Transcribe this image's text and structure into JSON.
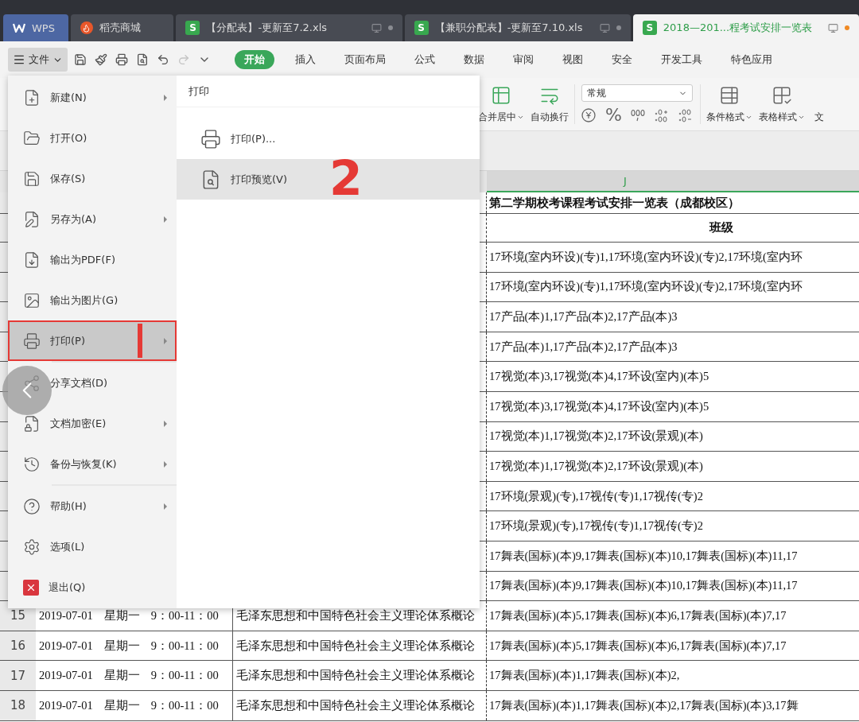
{
  "tabs": [
    {
      "kind": "home",
      "label": "WPS",
      "selected": false
    },
    {
      "kind": "store",
      "label": "稻壳商城",
      "selected": false
    },
    {
      "kind": "sheet",
      "badge": "S",
      "label": "【分配表】-更新至7.2.xls",
      "selected": false
    },
    {
      "kind": "sheet",
      "badge": "S",
      "label": "【兼职分配表】-更新至7.10.xls",
      "selected": false
    },
    {
      "kind": "sheet",
      "badge": "S",
      "label": "2018—201...程考试安排一览表",
      "selected": true
    }
  ],
  "menu_bar": {
    "file_button": {
      "label": "文件",
      "pressed": true
    },
    "quick_access": [
      {
        "kind": "save",
        "disabled": false
      },
      {
        "kind": "format",
        "disabled": false
      },
      {
        "kind": "print",
        "disabled": false
      },
      {
        "kind": "preview",
        "disabled": false
      },
      {
        "kind": "undo",
        "disabled": false
      },
      {
        "kind": "redo",
        "disabled": true
      },
      {
        "kind": "more",
        "disabled": false
      }
    ],
    "ribbon_tabs": [
      {
        "label": "开始",
        "selected": true
      },
      {
        "label": "插入",
        "selected": false
      },
      {
        "label": "页面布局",
        "selected": false
      },
      {
        "label": "公式",
        "selected": false
      },
      {
        "label": "数据",
        "selected": false
      },
      {
        "label": "审阅",
        "selected": false
      },
      {
        "label": "视图",
        "selected": false
      },
      {
        "label": "安全",
        "selected": false
      },
      {
        "label": "开发工具",
        "selected": false
      },
      {
        "label": "特色应用",
        "selected": false
      }
    ]
  },
  "ribbon": {
    "merge_label": "合并居中",
    "wrap_label": "自动换行",
    "number_format": {
      "value": "常规"
    },
    "percent": "%",
    "conditional_label": "条件格式",
    "table_style_label": "表格样式",
    "cut_label": "文"
  },
  "sheet": {
    "column_header": "J",
    "title": "第二学期校考课程考试安排一览表（成都校区）",
    "class_header": "班级",
    "rows": [
      {
        "classes": "17环境(室内环设)(专)1,17环境(室内环设)(专)2,17环境(室内环"
      },
      {
        "classes": "17环境(室内环设)(专)1,17环境(室内环设)(专)2,17环境(室内环"
      },
      {
        "classes": "17产品(本)1,17产品(本)2,17产品(本)3"
      },
      {
        "classes": "17产品(本)1,17产品(本)2,17产品(本)3"
      },
      {
        "classes": "17视觉(本)3,17视觉(本)4,17环设(室内)(本)5"
      },
      {
        "classes": "17视觉(本)3,17视觉(本)4,17环设(室内)(本)5"
      },
      {
        "classes": "17视觉(本)1,17视觉(本)2,17环设(景观)(本)"
      },
      {
        "classes": "17视觉(本)1,17视觉(本)2,17环设(景观)(本)"
      },
      {
        "classes": "17环境(景观)(专),17视传(专)1,17视传(专)2"
      },
      {
        "classes": "17环境(景观)(专),17视传(专)1,17视传(专)2"
      },
      {
        "classes": "17舞表(国标)(本)9,17舞表(国标)(本)10,17舞表(国标)(本)11,17"
      },
      {
        "classes": "17舞表(国标)(本)9,17舞表(国标)(本)10,17舞表(国标)(本)11,17"
      },
      {
        "number": "15",
        "date": "2019-07-01",
        "weekday": "星期一",
        "time": "9：00-11：00",
        "course": "毛泽东思想和中国特色社会主义理论体系概论",
        "classes": "17舞表(国标)(本)5,17舞表(国标)(本)6,17舞表(国标)(本)7,17"
      },
      {
        "number": "16",
        "date": "2019-07-01",
        "weekday": "星期一",
        "time": "9：00-11：00",
        "course": "毛泽东思想和中国特色社会主义理论体系概论",
        "classes": "17舞表(国标)(本)5,17舞表(国标)(本)6,17舞表(国标)(本)7,17"
      },
      {
        "number": "17",
        "date": "2019-07-01",
        "weekday": "星期一",
        "time": "9：00-11：00",
        "course": "毛泽东思想和中国特色社会主义理论体系概论",
        "classes": "17舞表(国标)(本)1,17舞表(国标)(本)2,"
      },
      {
        "number": "18",
        "date": "2019-07-01",
        "weekday": "星期一",
        "time": "9：00-11：00",
        "course": "毛泽东思想和中国特色社会主义理论体系概论",
        "classes": "17舞表(国标)(本)1,17舞表(国标)(本)2,17舞表(国标)(本)3,17舞"
      }
    ]
  },
  "file_menu": {
    "sections": [
      [
        {
          "kind": "new",
          "label": "新建(N)",
          "submenu": true,
          "selected": false,
          "outlined": false
        },
        {
          "kind": "open",
          "label": "打开(O)",
          "submenu": false,
          "selected": false,
          "outlined": false
        },
        {
          "kind": "save",
          "label": "保存(S)",
          "submenu": false,
          "selected": false,
          "outlined": false
        },
        {
          "kind": "save_as",
          "label": "另存为(A)",
          "submenu": true,
          "selected": false,
          "outlined": false
        },
        {
          "kind": "pdf",
          "label": "输出为PDF(F)",
          "submenu": false,
          "selected": false,
          "outlined": false
        },
        {
          "kind": "image",
          "label": "输出为图片(G)",
          "submenu": false,
          "selected": false,
          "outlined": false
        },
        {
          "kind": "print",
          "label": "打印(P)",
          "submenu": true,
          "selected": true,
          "outlined": true
        }
      ],
      [
        {
          "kind": "share",
          "label": "分享文档(D)",
          "submenu": false,
          "selected": false,
          "outlined": false
        },
        {
          "kind": "encrypt",
          "label": "文档加密(E)",
          "submenu": true,
          "selected": false,
          "outlined": false
        },
        {
          "kind": "backup",
          "label": "备份与恢复(K)",
          "submenu": true,
          "selected": false,
          "outlined": false
        }
      ],
      [
        {
          "kind": "help",
          "label": "帮助(H)",
          "submenu": true,
          "selected": false,
          "outlined": false
        },
        {
          "kind": "options",
          "label": "选项(L)",
          "submenu": false,
          "selected": false,
          "outlined": false
        },
        {
          "kind": "exit",
          "label": "退出(Q)",
          "submenu": false,
          "selected": false,
          "outlined": false
        }
      ]
    ],
    "submenu": {
      "title": "打印",
      "items": [
        {
          "kind": "print",
          "label": "打印(P)...",
          "selected": false
        },
        {
          "kind": "preview",
          "label": "打印预览(V)",
          "selected": true,
          "step_label": "2"
        }
      ]
    }
  }
}
